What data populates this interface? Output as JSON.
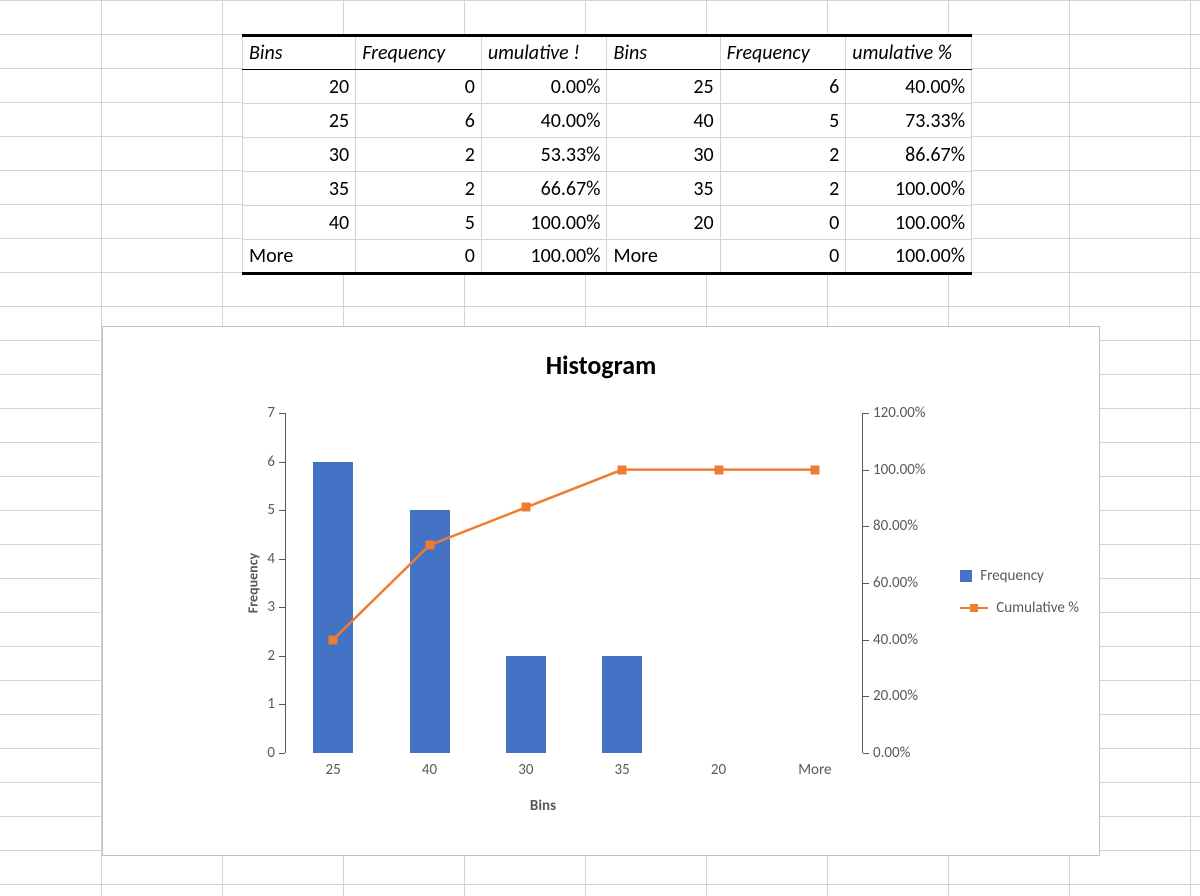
{
  "table": {
    "headers": {
      "bins": "Bins",
      "freq": "Frequency",
      "cum_trunc_a": "umulative !",
      "cum_trunc_b": "umulative %"
    },
    "left": [
      {
        "bin": "20",
        "freq": "0",
        "cum": "0.00%"
      },
      {
        "bin": "25",
        "freq": "6",
        "cum": "40.00%"
      },
      {
        "bin": "30",
        "freq": "2",
        "cum": "53.33%"
      },
      {
        "bin": "35",
        "freq": "2",
        "cum": "66.67%"
      },
      {
        "bin": "40",
        "freq": "5",
        "cum": "100.00%"
      },
      {
        "bin": "More",
        "freq": "0",
        "cum": "100.00%"
      }
    ],
    "right": [
      {
        "bin": "25",
        "freq": "6",
        "cum": "40.00%"
      },
      {
        "bin": "40",
        "freq": "5",
        "cum": "73.33%"
      },
      {
        "bin": "30",
        "freq": "2",
        "cum": "86.67%"
      },
      {
        "bin": "35",
        "freq": "2",
        "cum": "100.00%"
      },
      {
        "bin": "20",
        "freq": "0",
        "cum": "100.00%"
      },
      {
        "bin": "More",
        "freq": "0",
        "cum": "100.00%"
      }
    ]
  },
  "chart": {
    "title": "Histogram",
    "ylabel": "Frequency",
    "xlabel": "Bins",
    "left_ticks": [
      "0",
      "1",
      "2",
      "3",
      "4",
      "5",
      "6",
      "7"
    ],
    "right_ticks": [
      "0.00%",
      "20.00%",
      "40.00%",
      "60.00%",
      "80.00%",
      "100.00%",
      "120.00%"
    ],
    "legend": {
      "bar": "Frequency",
      "line": "Cumulative %"
    }
  },
  "chart_data": {
    "type": "bar",
    "title": "Histogram",
    "xlabel": "Bins",
    "ylabel": "Frequency",
    "categories": [
      "25",
      "40",
      "30",
      "35",
      "20",
      "More"
    ],
    "series": [
      {
        "name": "Frequency",
        "type": "bar",
        "values": [
          6,
          5,
          2,
          2,
          0,
          0
        ],
        "axis": "left"
      },
      {
        "name": "Cumulative %",
        "type": "line",
        "values": [
          40.0,
          73.33,
          86.67,
          100.0,
          100.0,
          100.0
        ],
        "axis": "right"
      }
    ],
    "ylim_left": [
      0,
      7
    ],
    "ylim_right": [
      0,
      120
    ]
  }
}
